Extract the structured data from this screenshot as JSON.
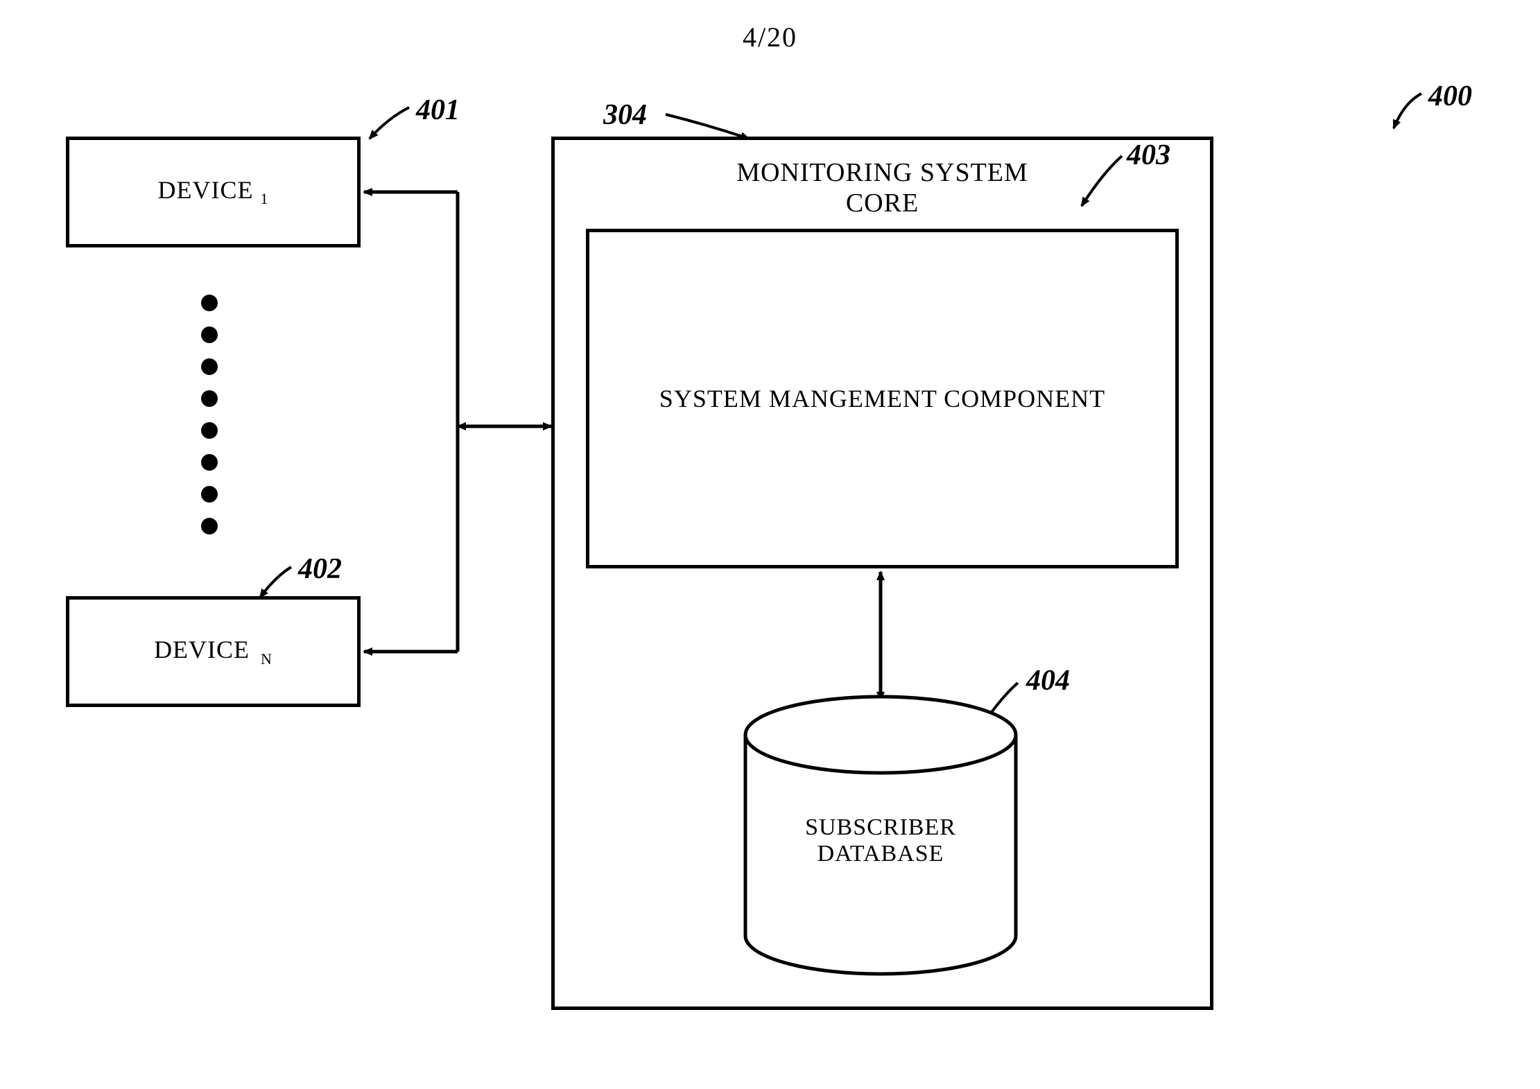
{
  "page_number": "4/20",
  "refs": {
    "r400": "400",
    "r401": "401",
    "r402": "402",
    "r403": "403",
    "r404": "404",
    "r304": "304"
  },
  "devices": {
    "device1_prefix": "DEVICE",
    "device1_sub": "1",
    "deviceN_prefix": "DEVICE",
    "deviceN_sub": "N"
  },
  "core": {
    "title_line1": "MONITORING SYSTEM",
    "title_line2": "CORE",
    "component_label": "SYSTEM MANGEMENT COMPONENT",
    "db_line1": "SUBSCRIBER",
    "db_line2": "DATABASE"
  }
}
